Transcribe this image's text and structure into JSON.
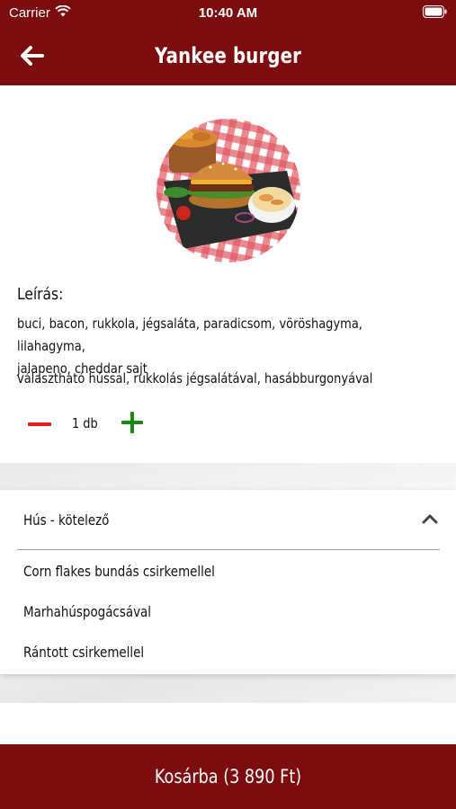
{
  "status_bar": {
    "carrier": "Carrier",
    "time": "10:40 AM",
    "wifi_icon": "wifi-icon",
    "battery_icon": "battery-icon"
  },
  "nav": {
    "title": "Yankee burger",
    "back_icon": "arrow-left-icon"
  },
  "product": {
    "image": "burger-plate-photo",
    "description_label": "Leírás:",
    "description_lines": [
      "buci, bacon, rukkola, jégsaláta, paradicsom, vöröshagyma, lilahagyma,",
      "jalapeno, cheddar sajt"
    ],
    "description_extra": "választható hússal, rukkolás jégsalátával, hasábburgonyával",
    "quantity": {
      "value": "1 db",
      "minus_icon": "minus-icon",
      "plus_icon": "plus-icon"
    }
  },
  "options": {
    "title": "Hús - kötelező",
    "chevron_icon": "chevron-up-icon",
    "items": [
      {
        "label": "Corn flakes bundás csirkemellel"
      },
      {
        "label": "Marhahúspogácsával"
      },
      {
        "label": "Rántott csirkemellel"
      }
    ]
  },
  "cart": {
    "label": "Kosárba (3 890 Ft)"
  },
  "colors": {
    "brand": "#7c0d0f",
    "minus": "#e0201d",
    "plus": "#1a8a14"
  }
}
